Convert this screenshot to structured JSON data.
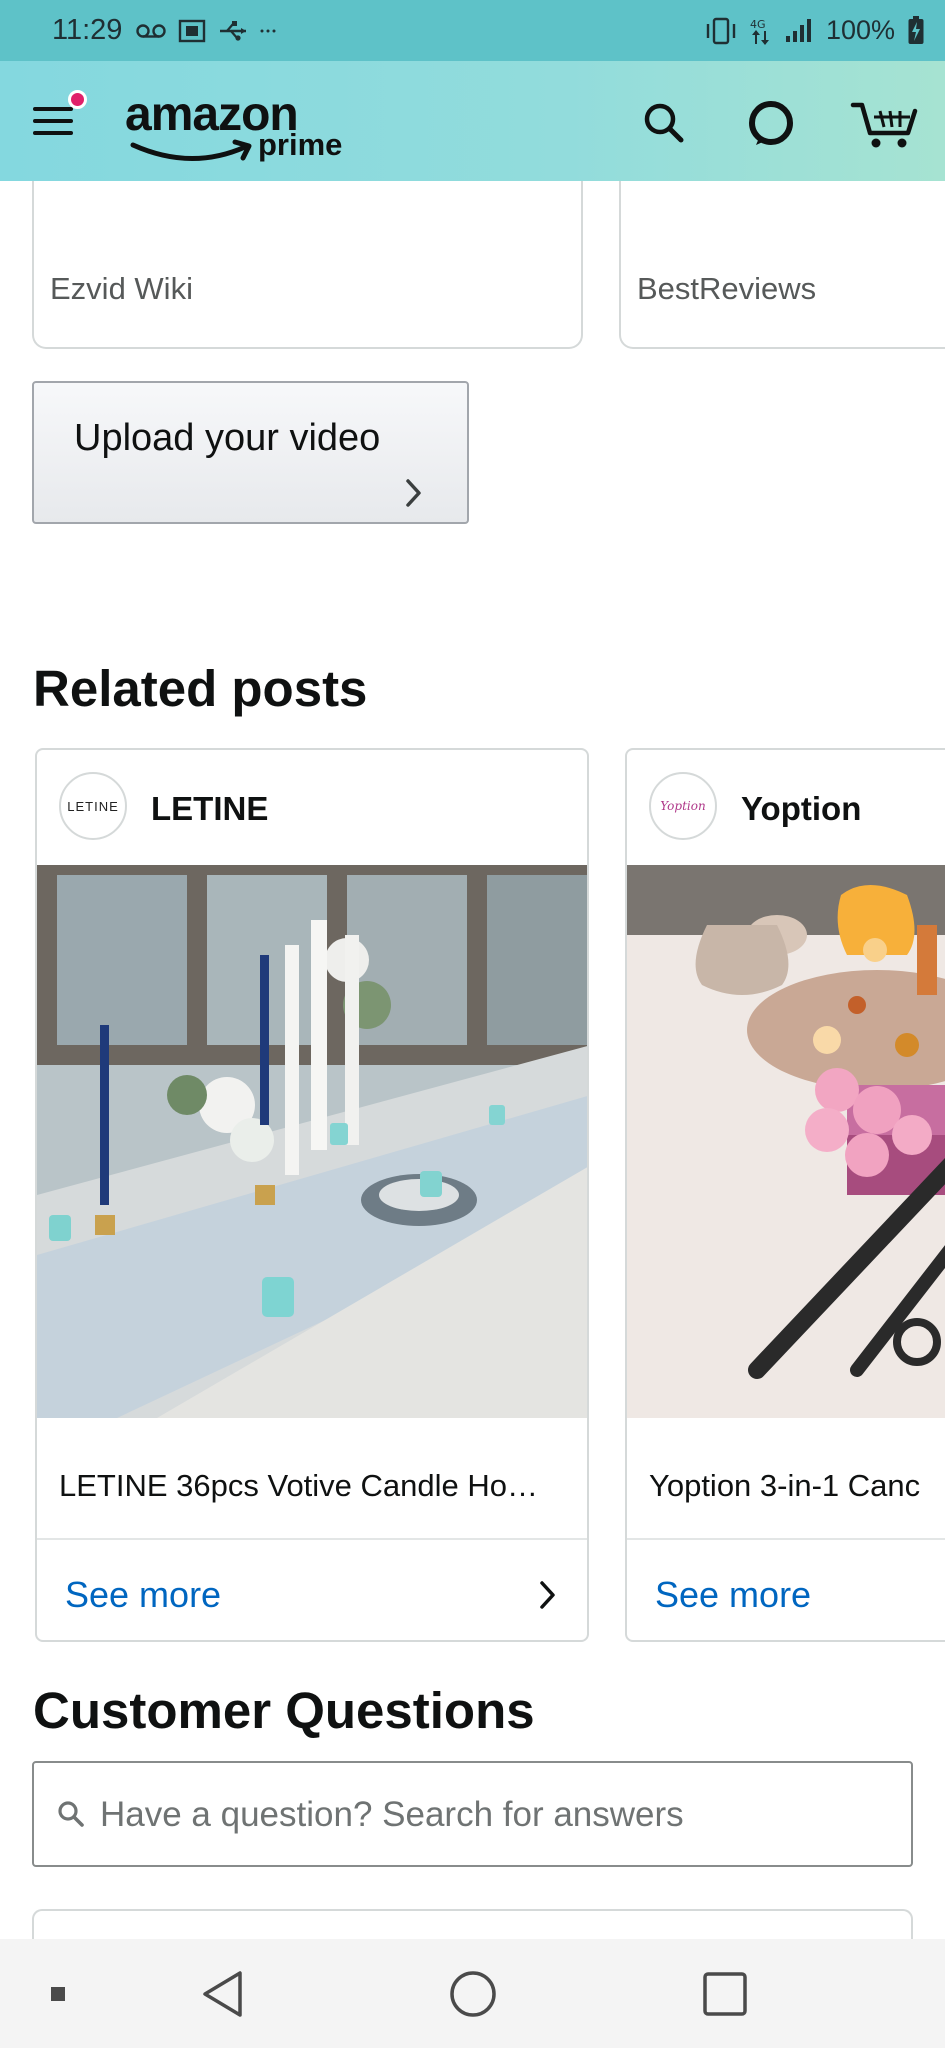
{
  "status_bar": {
    "time": "11:29",
    "left_icons": [
      "voicemail-icon",
      "shopping-bag-icon",
      "usb-icon",
      "more-dots-icon"
    ],
    "right_icons": [
      "vibrate-icon",
      "data-transfer-icon",
      "signal-icon"
    ],
    "battery": "100%",
    "color": "#5ec2c8"
  },
  "header": {
    "logo_word": "amazon",
    "logo_sub": "prime",
    "notification_dot_color": "#e0206a",
    "icons": [
      "menu-icon",
      "search-icon",
      "alexa-icon",
      "cart-icon"
    ]
  },
  "video_cards": [
    {
      "source": "Ezvid Wiki"
    },
    {
      "source": "BestReviews"
    }
  ],
  "upload_label": "Upload your video",
  "related_posts": {
    "title": "Related posts",
    "posts": [
      {
        "brand": "LETINE",
        "avatar_text": "LETINE",
        "title": "LETINE 36pcs Votive Candle Ho…",
        "see_more": "See more"
      },
      {
        "brand": "Yoption",
        "avatar_text": "Yoption",
        "title": "Yoption 3-in-1 Canc",
        "see_more": "See more"
      }
    ]
  },
  "customer_questions": {
    "title": "Customer Questions",
    "search_placeholder": "Have a question? Search for answers"
  },
  "nav_bar": {
    "items": [
      "overview-icon",
      "back-icon",
      "home-icon",
      "recents-icon"
    ]
  },
  "colors": {
    "link": "#0066c0",
    "header_start": "#84d8df",
    "header_end": "#a6e3d2",
    "text": "#0f1111"
  }
}
